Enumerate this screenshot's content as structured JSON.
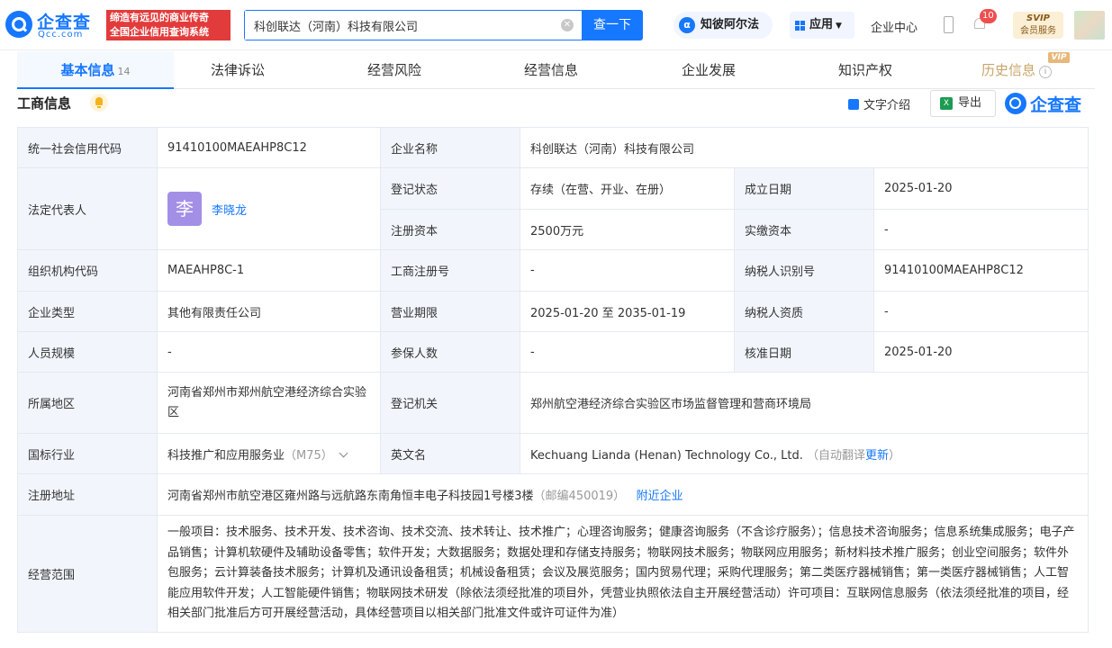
{
  "header": {
    "logo_cn": "企查查",
    "logo_en": "Qcc.com",
    "slogan_line1": "缔造有远见的商业传奇",
    "slogan_line2": "全国企业信用查询系统",
    "search_value": "科创联达（河南）科技有限公司",
    "search_button": "查一下",
    "alpha_label": "知彼阿尔法",
    "apps_label": "应用",
    "center_label": "企业中心",
    "notification_count": "10",
    "svip_line1": "SVIP",
    "svip_line2": "会员服务"
  },
  "tabs": [
    {
      "label": "基本信息",
      "count": "14"
    },
    {
      "label": "法律诉讼"
    },
    {
      "label": "经营风险"
    },
    {
      "label": "经营信息"
    },
    {
      "label": "企业发展"
    },
    {
      "label": "知识产权"
    },
    {
      "label": "历史信息",
      "badge": "VIP"
    }
  ],
  "section": {
    "title": "工商信息",
    "text_intro": "文字介绍",
    "export": "导出",
    "brand": "企查查"
  },
  "table": {
    "credit_code_label": "统一社会信用代码",
    "credit_code": "91410100MAEAHP8C12",
    "company_name_label": "企业名称",
    "company_name": "科创联达（河南）科技有限公司",
    "legal_rep_label": "法定代表人",
    "legal_rep_avatar": "李",
    "legal_rep": "李晓龙",
    "status_label": "登记状态",
    "status": "存续（在营、开业、在册）",
    "founded_label": "成立日期",
    "founded": "2025-01-20",
    "reg_capital_label": "注册资本",
    "reg_capital": "2500万元",
    "paid_capital_label": "实缴资本",
    "paid_capital": "-",
    "org_code_label": "组织机构代码",
    "org_code": "MAEAHP8C-1",
    "reg_no_label": "工商注册号",
    "reg_no": "-",
    "tax_id_label": "纳税人识别号",
    "tax_id": "91410100MAEAHP8C12",
    "type_label": "企业类型",
    "type": "其他有限责任公司",
    "term_label": "营业期限",
    "term": "2025-01-20 至 2035-01-19",
    "taxpayer_label": "纳税人资质",
    "taxpayer": "-",
    "staff_label": "人员规模",
    "staff": "-",
    "insured_label": "参保人数",
    "insured": "-",
    "approved_label": "核准日期",
    "approved": "2025-01-20",
    "region_label": "所属地区",
    "region": "河南省郑州市郑州航空港经济综合实验区",
    "authority_label": "登记机关",
    "authority": "郑州航空港经济综合实验区市场监督管理和营商环境局",
    "industry_label": "国标行业",
    "industry": "科技推广和应用服务业",
    "industry_code": "（M75）",
    "english_label": "英文名",
    "english": "Kechuang Lianda (Henan) Technology Co., Ltd.",
    "translate_note": "（自动翻译",
    "translate_update": "更新",
    "translate_end": "）",
    "address_label": "注册地址",
    "address": "河南省郑州市航空港区雍州路与远航路东南角恒丰电子科技园1号楼3楼",
    "postcode": "（邮编450019）",
    "nearby": "附近企业",
    "scope_label": "经营范围",
    "scope": "一般项目：技术服务、技术开发、技术咨询、技术交流、技术转让、技术推广；心理咨询服务；健康咨询服务（不含诊疗服务）；信息技术咨询服务；信息系统集成服务；电子产品销售；计算机软硬件及辅助设备零售；软件开发；大数据服务；数据处理和存储支持服务；物联网技术服务；物联网应用服务；新材料技术推广服务；创业空间服务；软件外包服务；云计算装备技术服务；计算机及通讯设备租赁；机械设备租赁；会议及展览服务；国内贸易代理；采购代理服务；第二类医疗器械销售；第一类医疗器械销售；人工智能应用软件开发；人工智能硬件销售；物联网技术研发（除依法须经批准的项目外，凭营业执照依法自主开展经营活动）许可项目：互联网信息服务（依法须经批准的项目，经相关部门批准后方可开展经营活动，具体经营项目以相关部门批准文件或许可证件为准）"
  }
}
